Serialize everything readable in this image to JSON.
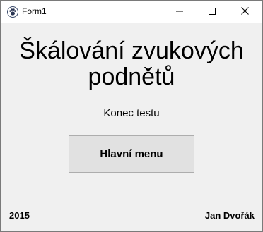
{
  "window": {
    "title": "Form1",
    "icon": "paw-icon"
  },
  "caption_buttons": {
    "minimize": "minimize-icon",
    "maximize": "maximize-icon",
    "close": "close-icon"
  },
  "main": {
    "heading_line1": "Škálování zvukových",
    "heading_line2": "podnětů",
    "status_text": "Konec testu",
    "main_menu_button": "Hlavní menu"
  },
  "footer": {
    "year": "2015",
    "author": "Jan Dvořák"
  }
}
